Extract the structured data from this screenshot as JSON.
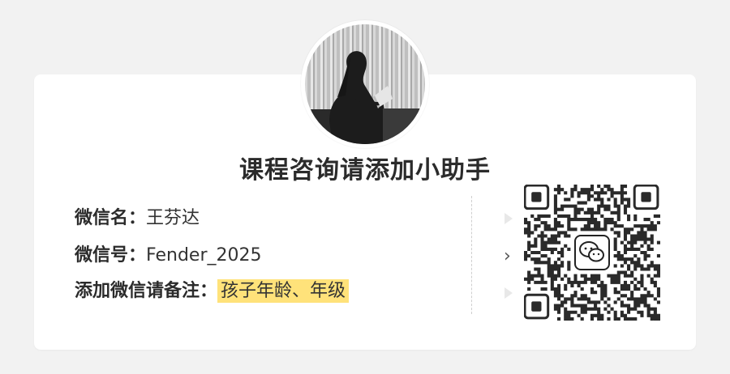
{
  "title": "课程咨询请添加小助手",
  "contact": {
    "wechat_name_label": "微信名：",
    "wechat_name_value": "王芬达",
    "wechat_id_label": "微信号：",
    "wechat_id_value": "Fender_2025",
    "note_label": "添加微信请备注：",
    "note_value": "孩子年龄、年级"
  },
  "colors": {
    "highlight": "#ffe27a",
    "title": "#2b2b2b",
    "background": "#f2f2f2"
  },
  "icons": {
    "avatar": "person-reading-photo",
    "qr_center": "wechat-icon",
    "scan_hint": "chevron-right-icon"
  }
}
